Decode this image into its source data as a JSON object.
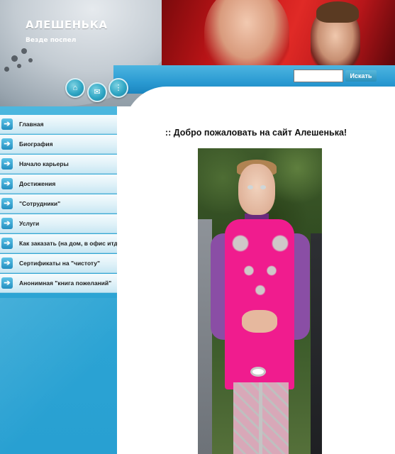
{
  "header": {
    "site_title": "АЛЕШЕНЬКА",
    "tagline": "Везде поспел",
    "nav_icons": [
      {
        "icon": "home-icon",
        "glyph": "⌂"
      },
      {
        "icon": "mail-icon",
        "glyph": "✉"
      },
      {
        "icon": "sitemap-icon",
        "glyph": "⋮"
      }
    ],
    "search": {
      "placeholder": "",
      "value": "",
      "button_label": "Искать"
    }
  },
  "sidebar": {
    "items": [
      {
        "label": "Главная"
      },
      {
        "label": "Биография"
      },
      {
        "label": "Начало карьеры"
      },
      {
        "label": "Достижения"
      },
      {
        "label": "\"Сотрудники\""
      },
      {
        "label": "Услуги"
      },
      {
        "label": "Как заказать (на дом, в офис итд.)"
      },
      {
        "label": "Сертификаты на \"чистоту\""
      },
      {
        "label": "Анонимная \"книга пожеланий\""
      }
    ]
  },
  "main": {
    "welcome": ":: Добро пожаловать на сайт Алешенька!"
  },
  "colors": {
    "accent_blue": "#2ea6d5",
    "header_red": "#c31518",
    "vest_pink": "#f01c8e",
    "shirt_purple": "#8a4ea5"
  }
}
